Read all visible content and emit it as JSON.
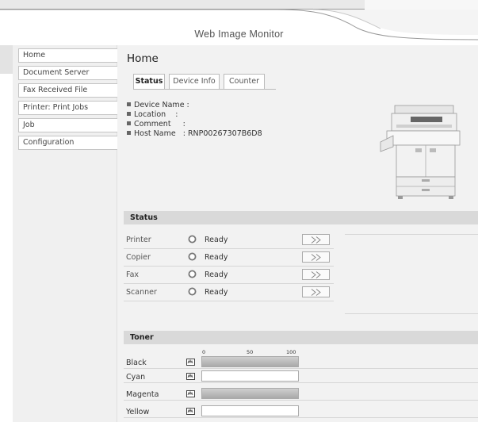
{
  "app_title": "Web Image Monitor",
  "sidebar": {
    "items": [
      {
        "label": "Home"
      },
      {
        "label": "Document Server"
      },
      {
        "label": "Fax Received File"
      },
      {
        "label": "Printer: Print Jobs"
      },
      {
        "label": "Job"
      },
      {
        "label": "Configuration"
      }
    ]
  },
  "main": {
    "title": "Home",
    "tabs": [
      {
        "label": "Status",
        "active": true
      },
      {
        "label": "Device Info",
        "active": false
      },
      {
        "label": "Counter",
        "active": false
      }
    ],
    "info": [
      {
        "text": "Device Name :"
      },
      {
        "text": "Location    :"
      },
      {
        "text": "Comment     :"
      },
      {
        "text": "Host Name   : RNP00267307B6D8"
      }
    ],
    "status_section": {
      "title": "Status",
      "rows": [
        {
          "label": "Printer",
          "value": "Ready",
          "icon": "ready-circle-icon"
        },
        {
          "label": "Copier",
          "value": "Ready",
          "icon": "ready-circle-icon"
        },
        {
          "label": "Fax",
          "value": "Ready",
          "icon": "ready-circle-icon"
        },
        {
          "label": "Scanner",
          "value": "Ready",
          "icon": "ready-circle-icon"
        }
      ]
    },
    "toner_section": {
      "title": "Toner",
      "scale": [
        "0",
        "50",
        "100"
      ],
      "rows": [
        {
          "label": "Black",
          "level": 100
        },
        {
          "label": "Cyan",
          "level": 0
        },
        {
          "label": "Magenta",
          "level": 100
        },
        {
          "label": "Yellow",
          "level": 0
        }
      ]
    }
  },
  "colors": {
    "sidebar_bg": "#f0f0f0",
    "main_bg": "#f2f2f2",
    "section_header_bg": "#d9d9d9",
    "toner_fill": "#b5b5b5"
  }
}
